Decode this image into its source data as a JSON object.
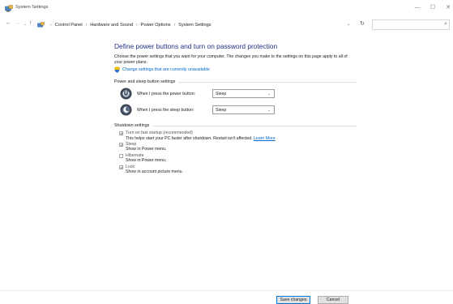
{
  "window": {
    "title": "System Settings",
    "minimize": "—",
    "maximize": "☐",
    "close": "✕"
  },
  "nav": {
    "back": "←",
    "forward": "→",
    "dropdown": "⌄",
    "up": "↑",
    "refresh": "↻",
    "search_icon": "⌕"
  },
  "breadcrumb": [
    "Control Panel",
    "Hardware and Sound",
    "Power Options",
    "System Settings"
  ],
  "breadcrumb_sep": "›",
  "page": {
    "title": "Define power buttons and turn on password protection",
    "intro": "Choose the power settings that you want for your computer. The changes you make to the settings on this page apply to all of your power plans.",
    "change_link": "Change settings that are currently unavailable"
  },
  "power_section": {
    "header": "Power and sleep button settings",
    "rows": [
      {
        "label": "When I press the power button:",
        "value": "Sleep"
      },
      {
        "label": "When I press the sleep button:",
        "value": "Sleep"
      }
    ]
  },
  "shutdown_section": {
    "header": "Shutdown settings",
    "items": [
      {
        "label": "Turn on fast startup (recommended)",
        "desc": "This helps start your PC faster after shutdown. Restart isn't affected.",
        "link": "Learn More",
        "checked": true
      },
      {
        "label": "Sleep",
        "desc": "Show in Power menu.",
        "checked": true
      },
      {
        "label": "Hibernate",
        "desc": "Show in Power menu.",
        "checked": false
      },
      {
        "label": "Lock",
        "desc": "Show in account picture menu.",
        "checked": true
      }
    ]
  },
  "footer": {
    "save": "Save changes",
    "cancel": "Cancel"
  },
  "colors": {
    "title_blue": "#1e3287",
    "link_blue": "#0066cc",
    "save_border": "#0078d7"
  }
}
